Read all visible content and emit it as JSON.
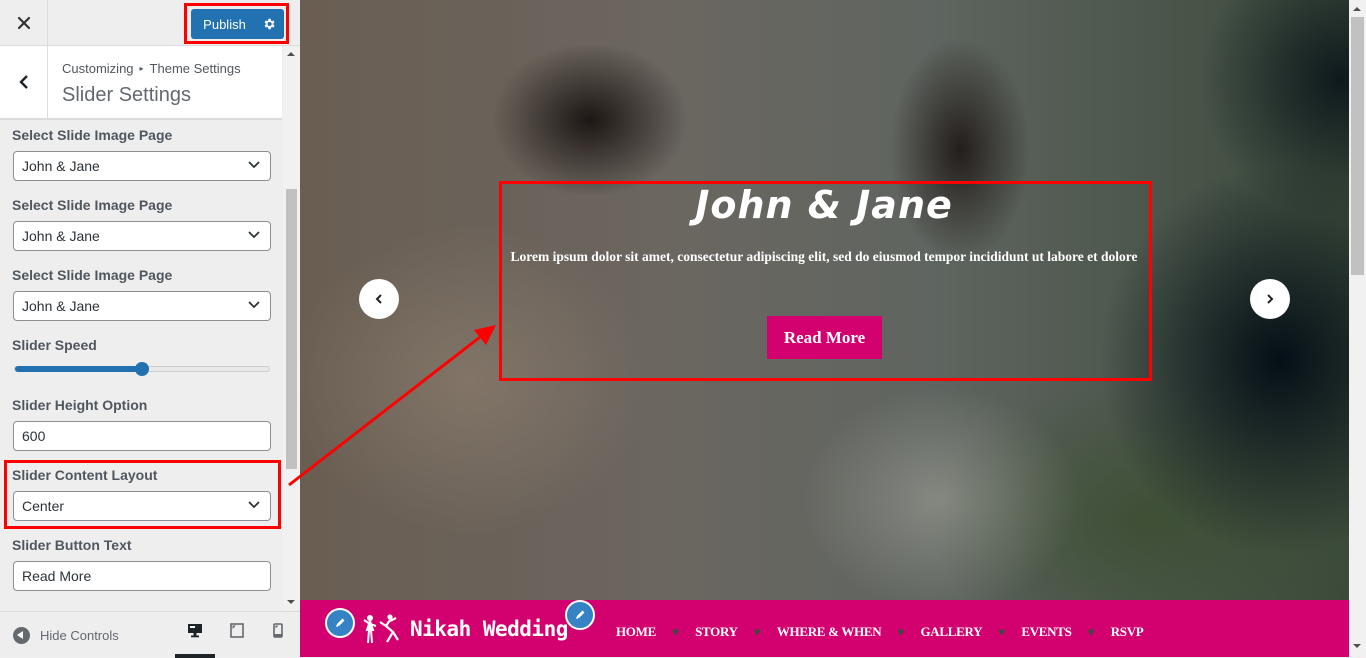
{
  "topbar": {
    "close_icon": "close-icon",
    "publish_label": "Publish",
    "publish_settings_icon": "gear-icon"
  },
  "section": {
    "breadcrumb_root": "Customizing",
    "breadcrumb_sep": "▸",
    "breadcrumb_parent": "Theme Settings",
    "title": "Slider Settings"
  },
  "controls": {
    "slide_pages": [
      {
        "label": "Select Slide Image Page",
        "value": "John & Jane"
      },
      {
        "label": "Select Slide Image Page",
        "value": "John & Jane"
      },
      {
        "label": "Select Slide Image Page",
        "value": "John & Jane"
      }
    ],
    "slider_speed": {
      "label": "Slider Speed",
      "value_fraction": 0.5
    },
    "slider_height": {
      "label": "Slider Height Option",
      "value": "600"
    },
    "content_layout": {
      "label": "Slider Content Layout",
      "value": "Center"
    },
    "button_text": {
      "label": "Slider Button Text",
      "value": "Read More"
    }
  },
  "footer": {
    "hide_controls_label": "Hide Controls",
    "devices": [
      "desktop",
      "tablet",
      "mobile"
    ],
    "active_device": "desktop"
  },
  "preview": {
    "slide": {
      "title": "John & Jane",
      "text": "Lorem ipsum dolor sit amet, consectetur adipiscing elit, sed do eiusmod tempor incididunt ut labore et dolore",
      "button_label": "Read More"
    },
    "site": {
      "logo_text": "Nikah Wedding",
      "menu": [
        "HOME",
        "STORY",
        "WHERE & WHEN",
        "GALLERY",
        "EVENTS",
        "RSVP"
      ],
      "menu_separator": "♥"
    }
  },
  "colors": {
    "accent": "#2271b1",
    "brand": "#d3006f",
    "highlight": "#ff0000"
  }
}
